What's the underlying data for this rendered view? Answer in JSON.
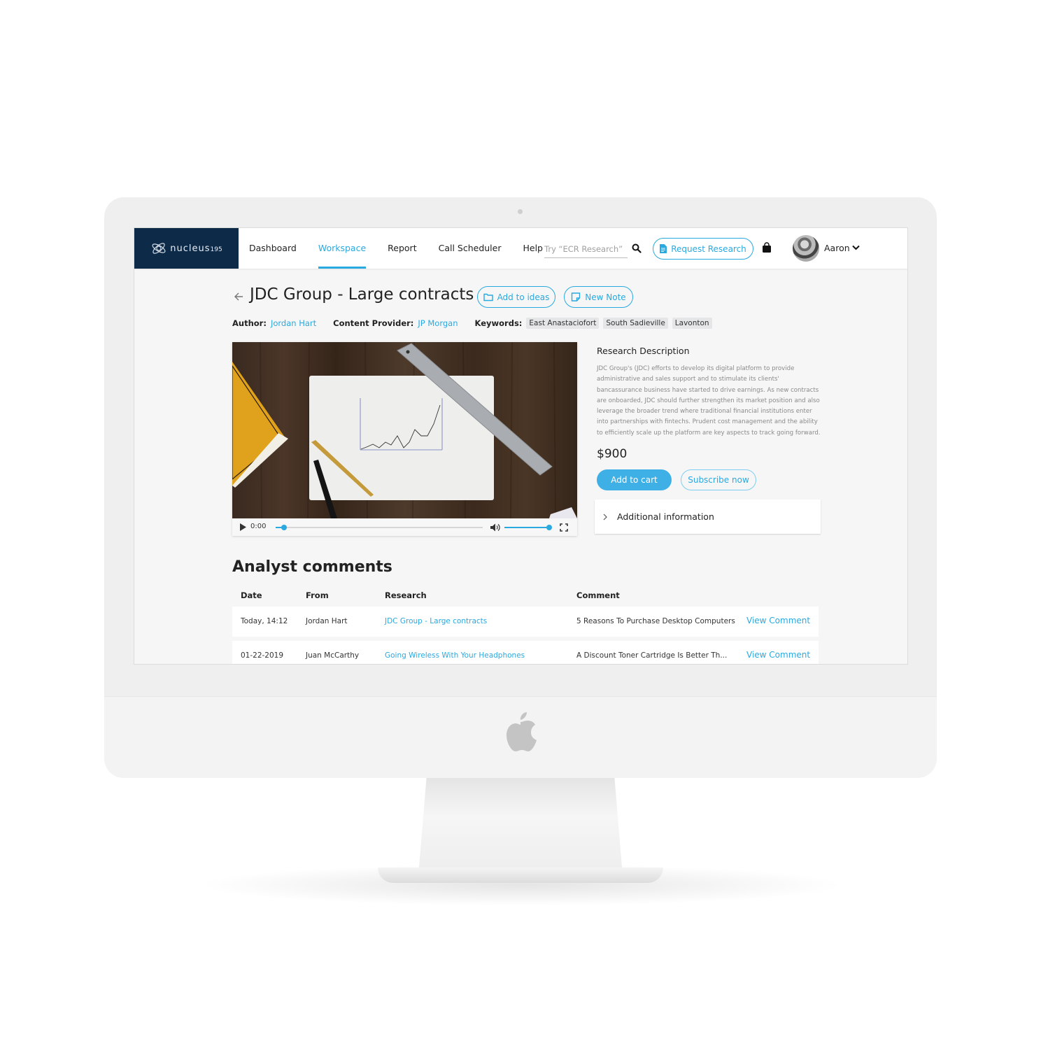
{
  "app": {
    "brand": "nucleus",
    "brand_suffix": "195"
  },
  "nav": {
    "items": [
      {
        "label": "Dashboard",
        "active": false
      },
      {
        "label": "Workspace",
        "active": true
      },
      {
        "label": "Report",
        "active": false
      },
      {
        "label": "Call Scheduler",
        "active": false
      },
      {
        "label": "Help",
        "active": false
      }
    ],
    "search_placeholder": "Try “ECR Research”",
    "search_value": "",
    "request_button": "Request Research",
    "user_name": "Aaron"
  },
  "research": {
    "title": "JDC Group - Large contracts",
    "add_to_ideas": "Add to ideas",
    "new_note": "New Note",
    "author_label": "Author:",
    "author": "Jordan Hart",
    "provider_label": "Content Provider:",
    "provider": "JP Morgan",
    "keywords_label": "Keywords:",
    "keywords": [
      "East Anastaciofort",
      "South Sadieville",
      "Lavonton"
    ],
    "description_title": "Research Description",
    "description": "JDC Group's (JDC) efforts to develop its digital platform to provide administrative and sales support and to stimulate its clients' bancassurance business have started to drive earnings. As new contracts are onboarded, JDC should further strengthen its market position and also leverage the broader trend where traditional financial institutions enter into partnerships with fintechs. Prudent cost management and the ability to efficiently scale up the platform are key aspects to track going forward.",
    "price": "$900",
    "add_to_cart": "Add to cart",
    "subscribe": "Subscribe now",
    "additional_info": "Additional information"
  },
  "video": {
    "time": "0:00",
    "progress_fraction": 0.04,
    "volume_fraction": 1.0
  },
  "comments": {
    "title": "Analyst comments",
    "headers": [
      "Date",
      "From",
      "Research",
      "Comment"
    ],
    "rows": [
      {
        "date": "Today, 14:12",
        "from": "Jordan Hart",
        "research": "JDC Group - Large contracts",
        "comment": "5 Reasons To Purchase Desktop Computers",
        "action": "View Comment"
      },
      {
        "date": "01-22-2019",
        "from": "Juan McCarthy",
        "research": "Going Wireless With Your Headphones",
        "comment": "A Discount Toner Cartridge Is Better Th...",
        "action": "View Comment"
      }
    ]
  },
  "colors": {
    "accent": "#29a9e0",
    "brand_navy": "#0d2a49"
  }
}
